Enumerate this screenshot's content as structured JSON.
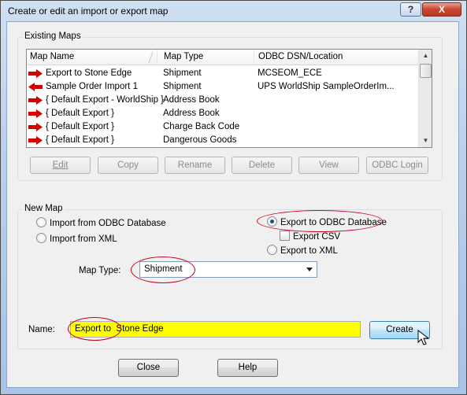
{
  "window": {
    "title": "Create or edit an import or export map",
    "help_button": "?",
    "close_button": "X"
  },
  "existing_maps": {
    "legend": "Existing Maps",
    "columns": [
      "Map Name",
      "Map Type",
      "ODBC DSN/Location"
    ],
    "rows": [
      {
        "name": "Export to Stone Edge",
        "type": "Shipment",
        "location": "MCSEOM_ECE",
        "icon": "export-arrow-icon"
      },
      {
        "name": "Sample Order Import 1",
        "type": "Shipment",
        "location": "UPS WorldShip SampleOrderIm...",
        "icon": "import-arrow-icon"
      },
      {
        "name": "{ Default Export - WorldShip }",
        "type": "Address Book",
        "location": "",
        "icon": "export-arrow-icon"
      },
      {
        "name": "{ Default Export }",
        "type": "Address Book",
        "location": "",
        "icon": "export-arrow-icon"
      },
      {
        "name": "{ Default Export }",
        "type": "Charge Back Code",
        "location": "",
        "icon": "export-arrow-icon"
      },
      {
        "name": "{ Default Export }",
        "type": "Dangerous Goods",
        "location": "",
        "icon": "export-arrow-icon"
      }
    ],
    "buttons": {
      "edit": "Edit",
      "copy": "Copy",
      "rename": "Rename",
      "delete": "Delete",
      "view": "View",
      "odbc_login": "ODBC Login"
    }
  },
  "new_map": {
    "legend": "New Map",
    "import_odbc": "Import from ODBC Database",
    "import_xml": "Import from XML",
    "export_odbc": "Export to ODBC Database",
    "export_csv": "Export CSV",
    "export_xml": "Export to XML",
    "selected": "export_odbc",
    "export_csv_checked": false,
    "map_type_label": "Map Type:",
    "map_type_value": "Shipment"
  },
  "name_row": {
    "label": "Name:",
    "value": "Export to  Stone Edge",
    "create_button": "Create"
  },
  "footer": {
    "close_button": "Close",
    "help_button": "Help"
  },
  "colors": {
    "highlight_field": "#ffff00",
    "annotation_ellipse": "#c8001e",
    "arrow_icon": "#d40000"
  }
}
